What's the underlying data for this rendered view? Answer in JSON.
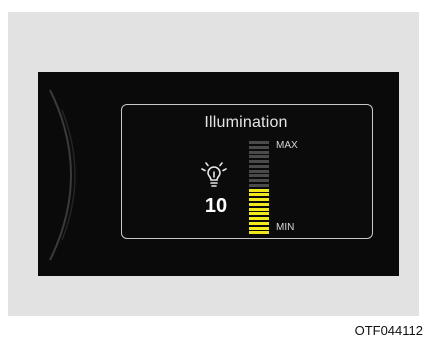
{
  "display": {
    "title": "Illumination",
    "value": "10",
    "max_label": "MAX",
    "min_label": "MIN",
    "level": {
      "current": 10,
      "total": 20
    },
    "icon": "brightness-bulb-icon",
    "colors": {
      "screen_bg": "#0a0a0a",
      "active_segment": "#f0e91e",
      "inactive_segment": "#4a4a4a",
      "text": "#e6e6e6"
    }
  },
  "caption": "OTF044112"
}
